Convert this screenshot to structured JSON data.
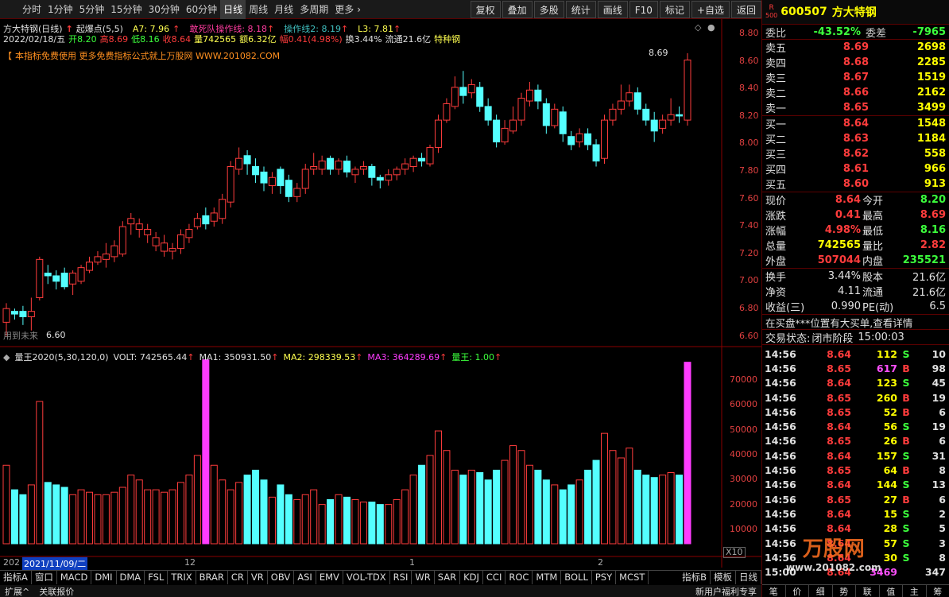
{
  "toolbar": {
    "periods": [
      "分时",
      "1分钟",
      "5分钟",
      "15分钟",
      "30分钟",
      "60分钟",
      "日线",
      "周线",
      "月线",
      "多周期",
      "更多"
    ],
    "right_buttons": [
      "复权",
      "叠加",
      "多股",
      "统计",
      "画线",
      "F10",
      "标记",
      "+自选",
      "返回"
    ]
  },
  "header": {
    "stock_title": "方大特钢(日线)",
    "indicator": "起爆点(5,5)",
    "a7": "A7: 7.96",
    "line_main": "敢死队操作线: 8.18",
    "line2": "操作线2: 8.19",
    "l3": "L3: 7.81",
    "date": "2022/02/18/五",
    "open": "开8.20",
    "high": "高8.69",
    "low": "低8.16",
    "close": "收8.64",
    "vol": "量742565",
    "amount": "额6.32亿",
    "change": "幅0.41(4.98%)",
    "turnover": "换3.44%",
    "float": "流通21.6亿",
    "sector": "特种钢",
    "ad_text": "本指标免费使用 更多免费指标公式就上万股网 WWW.201082.COM",
    "max_label": "8.69",
    "min_label": "6.60",
    "use_label": "用到未来"
  },
  "price_axis": [
    "8.80",
    "8.60",
    "8.40",
    "8.20",
    "8.00",
    "7.80",
    "7.60",
    "7.40",
    "7.20",
    "7.00",
    "6.80",
    "6.60"
  ],
  "volume_header": {
    "name": "量王2020(5,30,120,0)",
    "volt": "VOLT: 742565.44",
    "ma1": "MA1: 350931.50",
    "ma2": "MA2: 298339.53",
    "ma3": "MA3: 364289.69",
    "king": "量王: 1.00"
  },
  "volume_axis": [
    "70000",
    "60000",
    "50000",
    "40000",
    "30000",
    "20000",
    "10000"
  ],
  "volume_unit": "X10",
  "date_axis": {
    "left_year": "202",
    "cursor_date": "2021/11/09/二",
    "m12": "12",
    "m1": "1",
    "m2": "2"
  },
  "tabs": [
    "指标A",
    "窗口",
    "MACD",
    "DMI",
    "DMA",
    "FSL",
    "TRIX",
    "BRAR",
    "CR",
    "VR",
    "OBV",
    "ASI",
    "EMV",
    "VOL-TDX",
    "RSI",
    "WR",
    "SAR",
    "KDJ",
    "CCI",
    "ROC",
    "MTM",
    "BOLL",
    "PSY",
    "MCST"
  ],
  "tabs_right": [
    "指标B",
    "模板",
    "日线"
  ],
  "status": {
    "left1": "扩展^",
    "left2": "关联报价",
    "right": "新用户福利专享"
  },
  "panel": {
    "code": "600507",
    "name": "方大特钢",
    "r_label": "R",
    "r_num": "500",
    "weibi_label": "委比",
    "weibi": "-43.52%",
    "weicha_label": "委差",
    "weicha": "-7965",
    "asks": [
      {
        "label": "卖五",
        "price": "8.69",
        "vol": "2698"
      },
      {
        "label": "卖四",
        "price": "8.68",
        "vol": "2285"
      },
      {
        "label": "卖三",
        "price": "8.67",
        "vol": "1519"
      },
      {
        "label": "卖二",
        "price": "8.66",
        "vol": "2162"
      },
      {
        "label": "卖一",
        "price": "8.65",
        "vol": "3499"
      }
    ],
    "bids": [
      {
        "label": "买一",
        "price": "8.64",
        "vol": "1548"
      },
      {
        "label": "买二",
        "price": "8.63",
        "vol": "1184"
      },
      {
        "label": "买三",
        "price": "8.62",
        "vol": "558"
      },
      {
        "label": "买四",
        "price": "8.61",
        "vol": "966"
      },
      {
        "label": "买五",
        "price": "8.60",
        "vol": "913"
      }
    ],
    "stats": [
      {
        "l1": "现价",
        "v1": "8.64",
        "c1": "red",
        "l2": "今开",
        "v2": "8.20",
        "c2": "green"
      },
      {
        "l1": "涨跌",
        "v1": "0.41",
        "c1": "red",
        "l2": "最高",
        "v2": "8.69",
        "c2": "red"
      },
      {
        "l1": "涨幅",
        "v1": "4.98%",
        "c1": "red",
        "l2": "最低",
        "v2": "8.16",
        "c2": "green"
      },
      {
        "l1": "总量",
        "v1": "742565",
        "c1": "yel",
        "l2": "量比",
        "v2": "2.82",
        "c2": "red"
      },
      {
        "l1": "外盘",
        "v1": "507044",
        "c1": "red",
        "l2": "内盘",
        "v2": "235521",
        "c2": "green"
      }
    ],
    "stats2": [
      {
        "l1": "换手",
        "v1": "3.44%",
        "l2": "股本",
        "v2": "21.6亿"
      },
      {
        "l1": "净资",
        "v1": "4.11",
        "l2": "流通",
        "v2": "21.6亿"
      },
      {
        "l1": "收益(三)",
        "v1": "0.990",
        "l2": "PE(动)",
        "v2": "6.5"
      }
    ],
    "notice": "在买盘***位置有大买单,查看详情",
    "trade_state_label": "交易状态:",
    "trade_state": "闭市阶段",
    "trade_time": "15:00:03",
    "ticks": [
      {
        "t": "14:56",
        "p": "8.64",
        "pc": "red",
        "v": "112",
        "vc": "yel",
        "s": "S",
        "sc": "green",
        "n": "10"
      },
      {
        "t": "14:56",
        "p": "8.65",
        "pc": "red",
        "v": "617",
        "vc": "pink",
        "s": "B",
        "sc": "red",
        "n": "98"
      },
      {
        "t": "14:56",
        "p": "8.64",
        "pc": "red",
        "v": "123",
        "vc": "yel",
        "s": "S",
        "sc": "green",
        "n": "45"
      },
      {
        "t": "14:56",
        "p": "8.65",
        "pc": "red",
        "v": "260",
        "vc": "yel",
        "s": "B",
        "sc": "red",
        "n": "19"
      },
      {
        "t": "14:56",
        "p": "8.65",
        "pc": "red",
        "v": "52",
        "vc": "yel",
        "s": "B",
        "sc": "red",
        "n": "6"
      },
      {
        "t": "14:56",
        "p": "8.64",
        "pc": "red",
        "v": "56",
        "vc": "yel",
        "s": "S",
        "sc": "green",
        "n": "19"
      },
      {
        "t": "14:56",
        "p": "8.65",
        "pc": "red",
        "v": "26",
        "vc": "yel",
        "s": "B",
        "sc": "red",
        "n": "6"
      },
      {
        "t": "14:56",
        "p": "8.64",
        "pc": "red",
        "v": "157",
        "vc": "yel",
        "s": "S",
        "sc": "green",
        "n": "31"
      },
      {
        "t": "14:56",
        "p": "8.65",
        "pc": "red",
        "v": "64",
        "vc": "yel",
        "s": "B",
        "sc": "red",
        "n": "8"
      },
      {
        "t": "14:56",
        "p": "8.64",
        "pc": "red",
        "v": "144",
        "vc": "yel",
        "s": "S",
        "sc": "green",
        "n": "13"
      },
      {
        "t": "14:56",
        "p": "8.65",
        "pc": "red",
        "v": "27",
        "vc": "yel",
        "s": "B",
        "sc": "red",
        "n": "6"
      },
      {
        "t": "14:56",
        "p": "8.64",
        "pc": "red",
        "v": "15",
        "vc": "yel",
        "s": "S",
        "sc": "green",
        "n": "2"
      },
      {
        "t": "14:56",
        "p": "8.64",
        "pc": "red",
        "v": "28",
        "vc": "yel",
        "s": "S",
        "sc": "green",
        "n": "5"
      },
      {
        "t": "14:56",
        "p": "8.64",
        "pc": "red",
        "v": "57",
        "vc": "yel",
        "s": "S",
        "sc": "green",
        "n": "3"
      },
      {
        "t": "14:56",
        "p": "8.64",
        "pc": "red",
        "v": "30",
        "vc": "yel",
        "s": "S",
        "sc": "green",
        "n": "8"
      },
      {
        "t": "15:00",
        "p": "8.64",
        "pc": "red",
        "v": "3469",
        "vc": "pink",
        "s": "",
        "sc": "green",
        "n": "347"
      }
    ],
    "bottom_tabs": [
      "笔",
      "价",
      "细",
      "势",
      "联",
      "值",
      "主",
      "筹"
    ],
    "watermark": "万股网",
    "watermark_url": "www.201082.com"
  },
  "colors": {
    "up": "#ff3c3c",
    "down": "#54ffff",
    "ma_pink": "#ff3ca0",
    "band": "#6a0000",
    "vol_line_white": "#ffffff",
    "vol_line_yellow": "#ffff50",
    "vol_line_purple": "#c040ff"
  }
}
